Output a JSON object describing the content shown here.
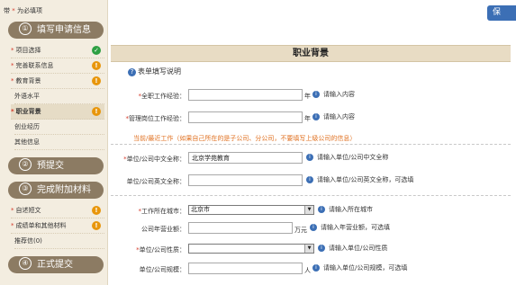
{
  "sidebar": {
    "required_note_prefix": "带",
    "required_note_star": "*",
    "required_note_suffix": "为必填项",
    "sections": [
      {
        "num": "①",
        "label": "填写申请信息"
      },
      {
        "num": "②",
        "label": "预提交"
      },
      {
        "num": "③",
        "label": "完成附加材料"
      },
      {
        "num": "④",
        "label": "正式提交"
      }
    ],
    "items": [
      {
        "label": "项目选择",
        "star": "*",
        "status": "✓"
      },
      {
        "label": "完善联系信息",
        "star": "*",
        "status": "!"
      },
      {
        "label": "教育背景",
        "star": "*",
        "status": "!"
      },
      {
        "label": "外语水平"
      },
      {
        "label": "职业背景",
        "star": "*",
        "status": "!"
      },
      {
        "label": "创业经历"
      },
      {
        "label": "其他信息"
      }
    ],
    "material_items": [
      {
        "label": "自述短文",
        "star": "*",
        "status": "!"
      },
      {
        "label": "成绩单和其他材料",
        "star": "*",
        "status": "!"
      },
      {
        "label": "推荐信(0)"
      }
    ]
  },
  "toolbar": {
    "save_label": "保"
  },
  "page": {
    "title": "职业背景",
    "help_label": "表单填写说明",
    "note": "当前/最近工作（如果自己所在的是子公司、分公司，不要填写上级公司的信息）"
  },
  "form": {
    "work_years": {
      "star": "*",
      "label": "全职工作经验：",
      "value": "",
      "unit": "年",
      "hint": "请输入内容"
    },
    "mgmt_years": {
      "star": "*",
      "label": "管理岗位工作经验：",
      "value": "",
      "unit": "年",
      "hint": "请输入内容"
    },
    "company_cn": {
      "star": "*",
      "label": "单位/公司中文全称：",
      "value": "北京学苑教育",
      "hint": "请输入单位/公司中文全称"
    },
    "company_en": {
      "label": "单位/公司英文全称：",
      "value": "",
      "hint": "请输入单位/公司英文全称，可选填"
    },
    "city": {
      "star": "*",
      "label": "工作所在城市：",
      "value": "北京市",
      "hint": "请输入所在城市"
    },
    "revenue": {
      "label": "公司年营业额：",
      "value": "",
      "unit": "万元",
      "hint": "请输入年营业额，可选填"
    },
    "nature": {
      "star": "*",
      "label": "单位/公司性质：",
      "value": "",
      "hint": "请输入单位/公司性质"
    },
    "scale": {
      "label": "单位/公司规模：",
      "value": "",
      "unit": "人",
      "hint": "请输入单位/公司规模，可选填"
    }
  }
}
